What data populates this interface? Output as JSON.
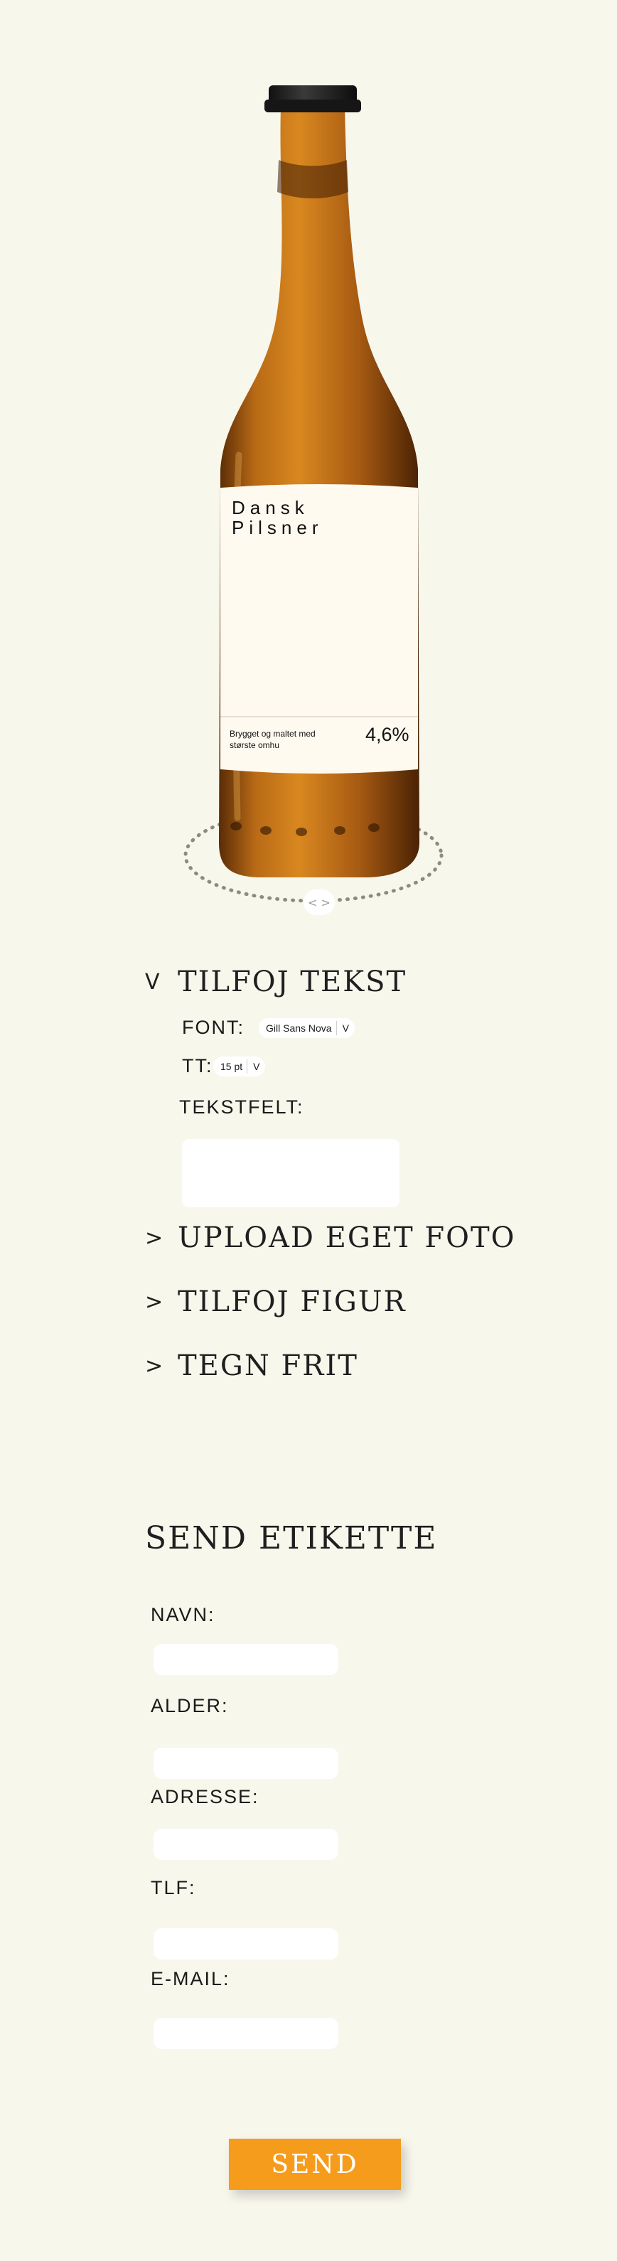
{
  "bottle": {
    "label_brand_line1": "Dansk",
    "label_brand_line2": "Pilsner",
    "label_tagline": "Brygget og maltet med største omhu",
    "label_abv": "4,6%",
    "rotate_handle": "< >"
  },
  "editor": {
    "add_text": {
      "chevron": "V",
      "title": "TILFOJ TEKST",
      "font_label": "FONT:",
      "font_value": "Gill Sans Nova",
      "font_arrow": "V",
      "size_label": "TT:",
      "size_value": "15 pt",
      "size_arrow": "V",
      "textfield_label": "TEKSTFELT:",
      "textfield_value": ""
    },
    "upload_photo": {
      "chevron": ">",
      "title": "UPLOAD EGET FOTO"
    },
    "add_shape": {
      "chevron": ">",
      "title": "TILFOJ FIGUR"
    },
    "free_draw": {
      "chevron": ">",
      "title": "TEGN FRIT"
    }
  },
  "form": {
    "title": "SEND ETIKETTE",
    "name_label": "NAVN:",
    "age_label": "ALDER:",
    "address_label": "ADRESSE:",
    "phone_label": "TLF:",
    "email_label": "E-MAIL:",
    "send_label": "SEND"
  },
  "colors": {
    "background": "#f8f7ec",
    "accent": "#f59c1c",
    "bottle_glass": "#a85a14",
    "label": "#fffaf0"
  }
}
